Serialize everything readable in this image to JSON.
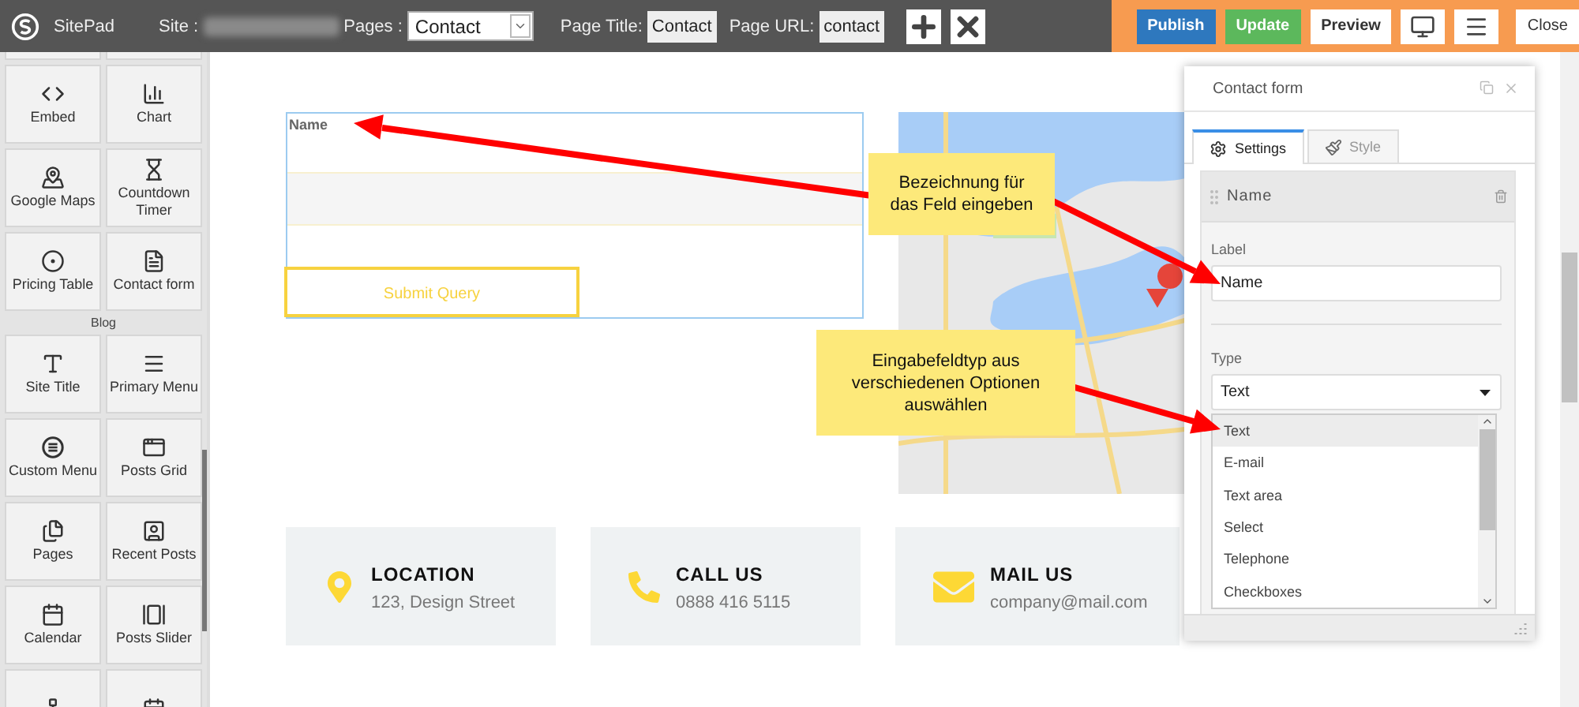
{
  "topbar": {
    "logo_text": "SitePad",
    "site_label": "Site :",
    "pages_label": "Pages :",
    "page_select": "Contact",
    "page_title_label": "Page Title:",
    "page_title": "Contact",
    "page_url_label": "Page URL:",
    "page_url": "contact",
    "buttons": [
      {
        "label": "Publish",
        "kind": "primary"
      },
      {
        "label": "Update",
        "kind": "success"
      },
      {
        "label": "Preview",
        "kind": "plain"
      }
    ],
    "close_button": "Close"
  },
  "sidebar": {
    "widgets": [
      {
        "label": "Embed"
      },
      {
        "label": "Chart"
      },
      {
        "label": "Google Maps"
      },
      {
        "label": "Countdown Timer"
      },
      {
        "label": "Pricing Table"
      },
      {
        "label": "Contact form"
      }
    ],
    "section_title": "Blog",
    "blog_widgets": [
      {
        "label": "Site Title"
      },
      {
        "label": "Primary Menu"
      },
      {
        "label": "Custom Menu"
      },
      {
        "label": "Posts Grid"
      },
      {
        "label": "Pages"
      },
      {
        "label": "Recent Posts"
      },
      {
        "label": "Calendar"
      },
      {
        "label": "Posts Slider"
      }
    ]
  },
  "form": {
    "field_label": "Name",
    "submit": "Submit Query"
  },
  "cards": [
    {
      "title": "LOCATION",
      "text": "123, Design Street"
    },
    {
      "title": "CALL US",
      "text": "0888 416 5115"
    },
    {
      "title": "MAIL US",
      "text": "company@mail.com"
    }
  ],
  "panel": {
    "title": "Contact form",
    "tabs": [
      {
        "label": "Settings",
        "selected": true
      },
      {
        "label": "Style",
        "selected": false
      }
    ],
    "field_header": "Name",
    "label_caption": "Label",
    "label_value": "Name",
    "type_caption": "Type",
    "type_value": "Text",
    "type_options": [
      {
        "label": "Text",
        "selected": true
      },
      {
        "label": "E-mail",
        "selected": false
      },
      {
        "label": "Text area",
        "selected": false
      },
      {
        "label": "Select",
        "selected": false
      },
      {
        "label": "Telephone",
        "selected": false
      },
      {
        "label": "Checkboxes",
        "selected": false
      }
    ]
  },
  "callouts": [
    {
      "text": "Bezeichnung für das Feld eingeben"
    },
    {
      "text": "Eingabefeldtyp aus verschiedenen Optionen auswählen"
    }
  ]
}
